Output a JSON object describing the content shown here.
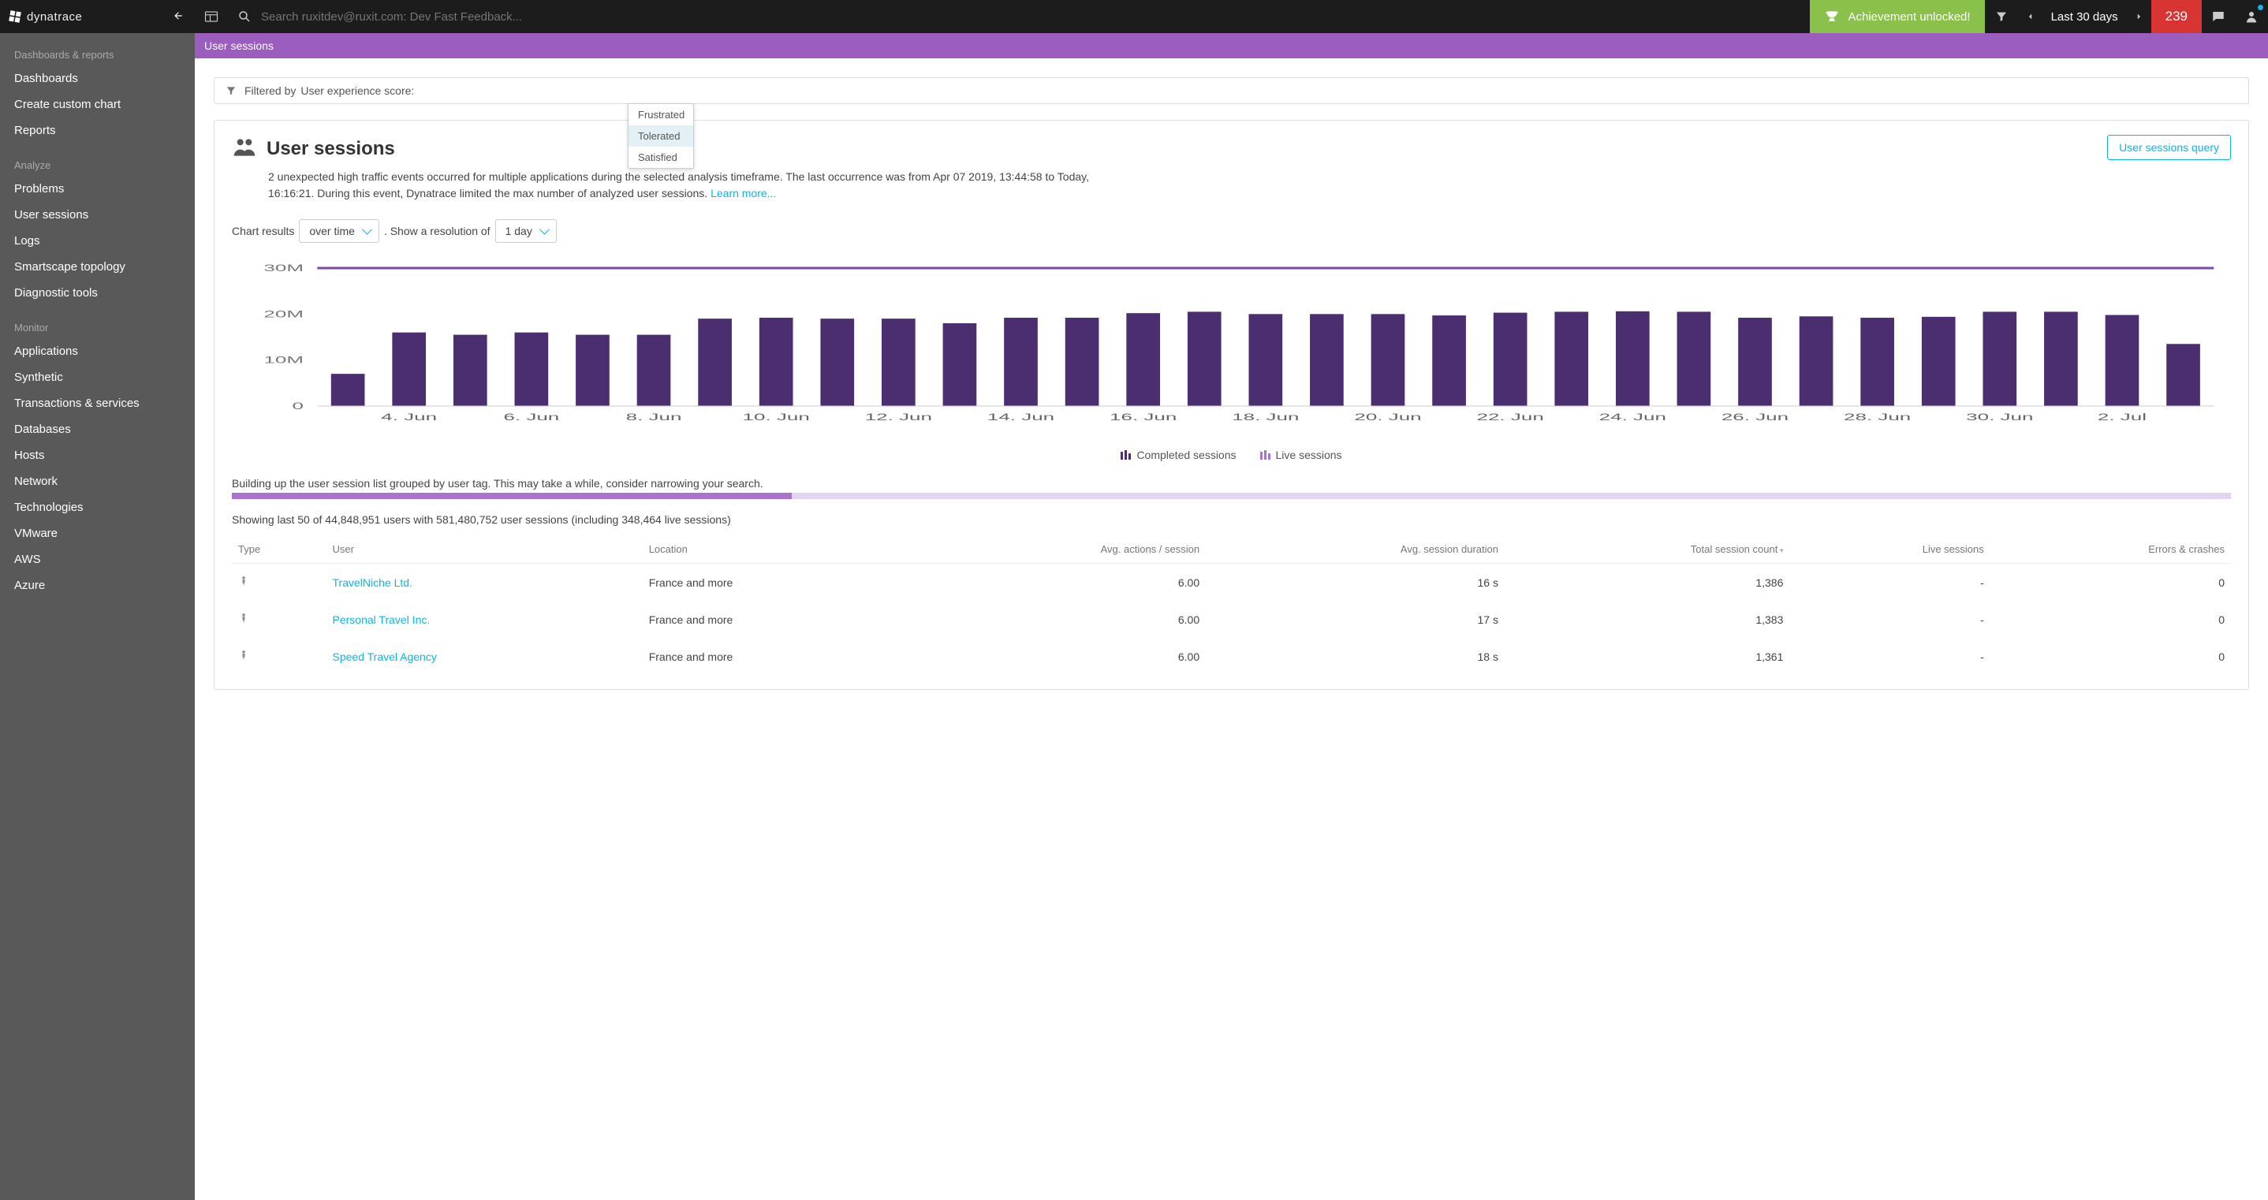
{
  "logo_text": "dynatrace",
  "topbar": {
    "search_placeholder": "Search ruxitdev@ruxit.com: Dev Fast Feedback...",
    "achievement": "Achievement unlocked!",
    "timeframe": "Last 30 days",
    "problem_count": "239"
  },
  "breadcrumb": "User sessions",
  "sidebar": {
    "sections": [
      {
        "title": "Dashboards & reports",
        "items": [
          "Dashboards",
          "Create custom chart",
          "Reports"
        ]
      },
      {
        "title": "Analyze",
        "items": [
          "Problems",
          "User sessions",
          "Logs",
          "Smartscape topology",
          "Diagnostic tools"
        ]
      },
      {
        "title": "Monitor",
        "items": [
          "Applications",
          "Synthetic",
          "Transactions & services",
          "Databases",
          "Hosts",
          "Network",
          "Technologies",
          "VMware",
          "AWS",
          "Azure"
        ]
      }
    ]
  },
  "filter": {
    "prefix": "Filtered by",
    "field_label": "User experience score:",
    "options": [
      "Frustrated",
      "Tolerated",
      "Satisfied"
    ],
    "selected_index": 1
  },
  "panel": {
    "title": "User sessions",
    "query_btn": "User sessions query",
    "desc_part1": "2 unexpected high traffic events occurred for multiple applications during the selected analysis timeframe. The last occurrence was from Apr 07 2019, 13:44:58 to Today, 16:16:21. During this event, Dynatrace limited the max number of analyzed user sessions. ",
    "learn_more": "Learn more...",
    "chart_results_label": "Chart results",
    "over_time": "over time",
    "resolution_label": ". Show a resolution of",
    "resolution_value": "1 day"
  },
  "chart_data": {
    "type": "bar",
    "title": "",
    "ylabel": "",
    "ylim": [
      0,
      30
    ],
    "yticks": [
      "0",
      "10M",
      "20M",
      "30M"
    ],
    "categories": [
      "3. Jun",
      "4. Jun",
      "5. Jun",
      "6. Jun",
      "7. Jun",
      "8. Jun",
      "9. Jun",
      "10. Jun",
      "11. Jun",
      "12. Jun",
      "13. Jun",
      "14. Jun",
      "15. Jun",
      "16. Jun",
      "17. Jun",
      "18. Jun",
      "19. Jun",
      "20. Jun",
      "21. Jun",
      "22. Jun",
      "23. Jun",
      "24. Jun",
      "25. Jun",
      "26. Jun",
      "27. Jun",
      "28. Jun",
      "29. Jun",
      "30. Jun",
      "1. Jul",
      "2. Jul",
      "3. Jul"
    ],
    "visible_xlabels": [
      "4. Jun",
      "6. Jun",
      "8. Jun",
      "10. Jun",
      "12. Jun",
      "14. Jun",
      "16. Jun",
      "18. Jun",
      "20. Jun",
      "22. Jun",
      "24. Jun",
      "26. Jun",
      "28. Jun",
      "30. Jun",
      "2. Jul"
    ],
    "series": [
      {
        "name": "Completed sessions",
        "color": "#4b2e6f",
        "values": [
          7,
          16,
          15.5,
          16,
          15.5,
          15.5,
          19,
          19.2,
          19,
          19,
          18,
          19.2,
          19.2,
          20.2,
          20.5,
          20,
          20,
          20,
          19.7,
          20.3,
          20.5,
          20.6,
          20.5,
          19.2,
          19.5,
          19.2,
          19.4,
          20.5,
          20.5,
          19.8,
          13.5
        ]
      },
      {
        "name": "Live sessions",
        "color": "#a874cf",
        "values": []
      }
    ],
    "topline_value": 30
  },
  "building_msg": "Building up the user session list grouped by user tag. This may take a while, consider narrowing your search.",
  "showing_text": "Showing last 50 of 44,848,951 users with 581,480,752 user sessions (including 348,464 live sessions)",
  "table": {
    "cols": [
      "Type",
      "User",
      "Location",
      "Avg. actions / session",
      "Avg. session du­ration",
      "Total session count",
      "Live ses­sions",
      "Errors & crashes"
    ],
    "rows": [
      {
        "user": "TravelNiche Ltd.",
        "location": "France and more",
        "actions": "6.00",
        "duration": "16 s",
        "count": "1,386",
        "live": "-",
        "errors": "0"
      },
      {
        "user": "Personal Travel Inc.",
        "location": "France and more",
        "actions": "6.00",
        "duration": "17 s",
        "count": "1,383",
        "live": "-",
        "errors": "0"
      },
      {
        "user": "Speed Travel Agency",
        "location": "France and more",
        "actions": "6.00",
        "duration": "18 s",
        "count": "1,361",
        "live": "-",
        "errors": "0"
      }
    ]
  }
}
